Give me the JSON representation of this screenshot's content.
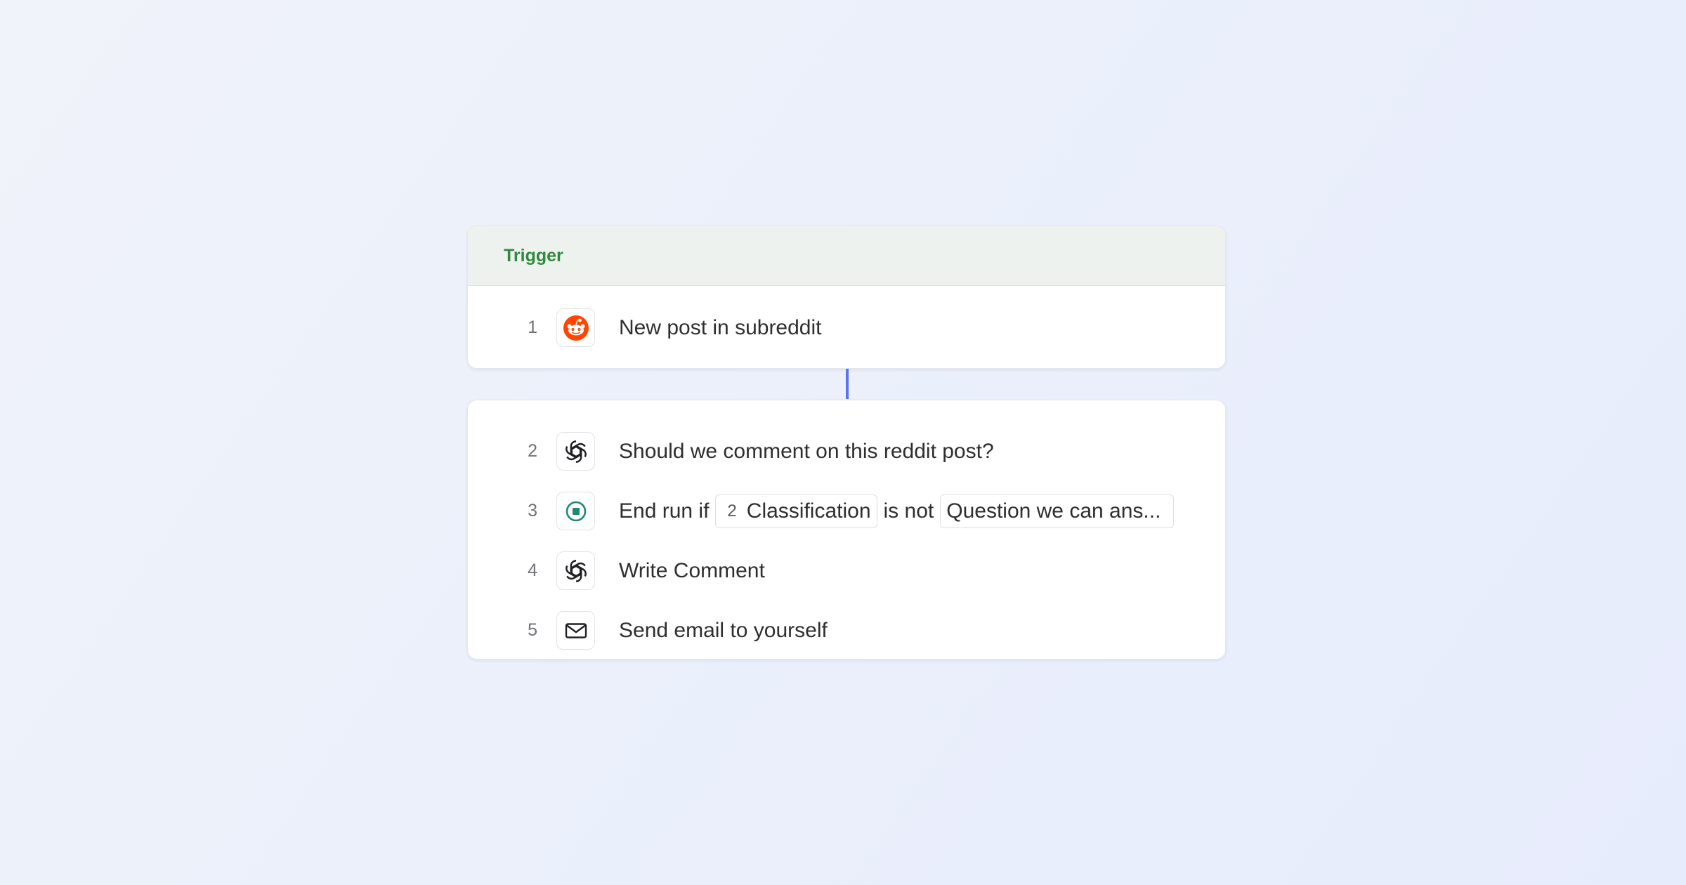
{
  "trigger": {
    "label": "Trigger",
    "step": {
      "number": "1",
      "icon": "reddit-icon",
      "text": "New post in subreddit"
    }
  },
  "steps": [
    {
      "number": "2",
      "icon": "openai-icon",
      "text": "Should we comment on this reddit post?"
    },
    {
      "number": "3",
      "icon": "stop-icon",
      "prefix": "End run if",
      "ref_number": "2",
      "ref_label": "Classification",
      "operator": "is not",
      "value": "Question we can ans..."
    },
    {
      "number": "4",
      "icon": "openai-icon",
      "text": "Write Comment"
    },
    {
      "number": "5",
      "icon": "mail-icon",
      "text": "Send email to yourself"
    }
  ],
  "colors": {
    "trigger_green": "#2e8a3e",
    "reddit_orange": "#ff4500",
    "stop_teal": "#1f8a70",
    "connector_blue": "#5b73f2"
  }
}
